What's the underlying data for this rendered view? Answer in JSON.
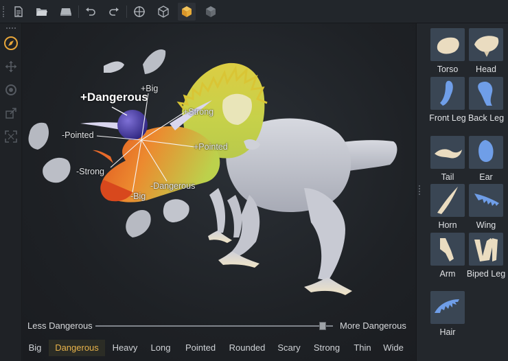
{
  "toolbar": {
    "buttons": [
      {
        "name": "new-document-icon"
      },
      {
        "name": "open-folder-icon"
      },
      {
        "name": "save-icon"
      },
      {
        "name": "undo-icon"
      },
      {
        "name": "redo-icon"
      },
      {
        "name": "target-view-icon"
      },
      {
        "name": "wireframe-cube-icon"
      },
      {
        "name": "solid-cube-icon",
        "active": true
      },
      {
        "name": "shaded-cube-icon"
      }
    ]
  },
  "left_tools": [
    "compass-icon",
    "move-icon",
    "rotate-icon",
    "scale-icon",
    "fit-view-icon"
  ],
  "viewport": {
    "blend_labels": {
      "main": "+Dangerous",
      "big_pos": "+Big",
      "strong_pos": "+Strong",
      "pointed_pos": "+Pointed",
      "pointed_neg": "-Pointed",
      "strong_neg": "-Strong",
      "dangerous_neg": "-Dangerous",
      "big_neg": "-Big"
    }
  },
  "slider": {
    "left_label": "Less Dangerous",
    "right_label": "More Dangerous",
    "value": 0.97
  },
  "attributes": {
    "tabs": [
      "Big",
      "Dangerous",
      "Heavy",
      "Long",
      "Pointed",
      "Rounded",
      "Scary",
      "Strong",
      "Thin",
      "Wide"
    ],
    "selected": "Dangerous"
  },
  "parts": [
    {
      "label": "Torso"
    },
    {
      "label": "Head"
    },
    {
      "label": "Front Leg"
    },
    {
      "label": "Back Leg"
    },
    {
      "label": "Tail"
    },
    {
      "label": "Ear"
    },
    {
      "label": "Horn"
    },
    {
      "label": "Wing"
    },
    {
      "label": "Arm"
    },
    {
      "label": "Biped Leg"
    },
    {
      "label": "Hair"
    }
  ],
  "colors": {
    "accent_selected": "#e8b34b",
    "compass_active": "#e9a73a",
    "blend_sphere": "#4b3fa0",
    "part_thumb_bg": "#3a4654",
    "part_blue": "#6f9ee8",
    "part_cream": "#eadcc0"
  }
}
